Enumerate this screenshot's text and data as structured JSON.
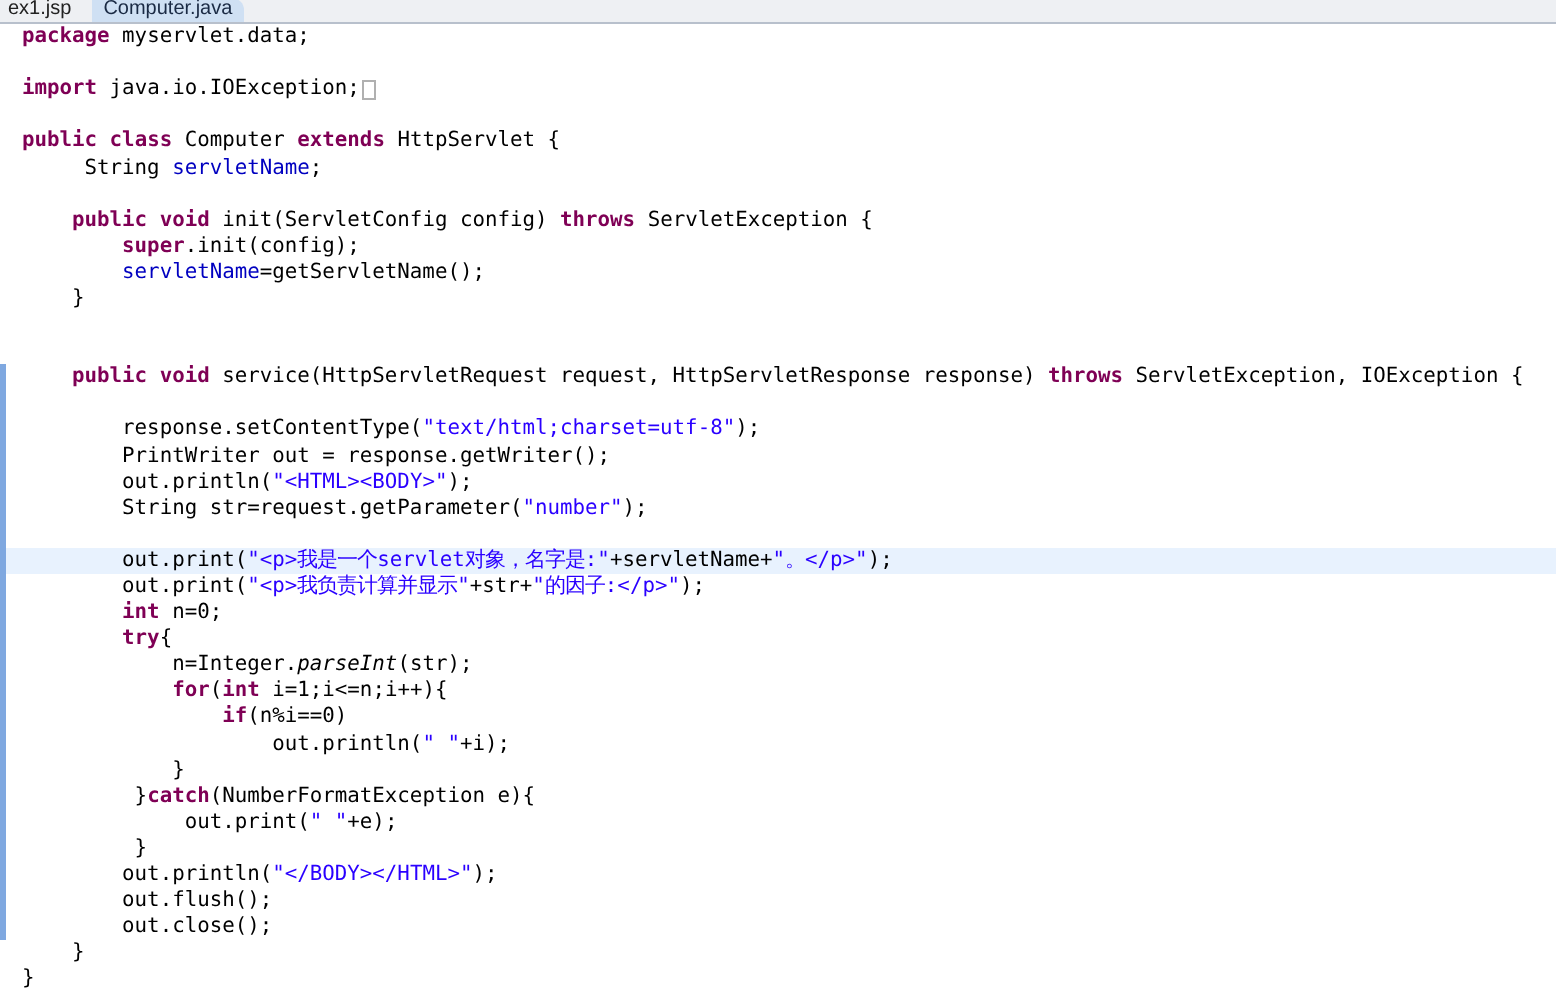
{
  "tabs": [
    {
      "label": "ex1.jsp",
      "selected": false
    },
    {
      "label": "Computer.java",
      "selected": true
    }
  ],
  "editor": {
    "lines": [
      {
        "kind": "code",
        "tokens": [
          {
            "kind": "kw",
            "t": "package"
          },
          {
            "kind": "plain",
            "t": " myservlet.data;"
          }
        ]
      },
      {
        "kind": "blank"
      },
      {
        "kind": "code",
        "tokens": [
          {
            "kind": "kw",
            "t": "import"
          },
          {
            "kind": "plain",
            "t": " java.io.IOException;"
          }
        ],
        "folded": true
      },
      {
        "kind": "blank"
      },
      {
        "kind": "code",
        "tokens": [
          {
            "kind": "kw",
            "t": "public"
          },
          {
            "kind": "kw",
            "t": " class"
          },
          {
            "kind": "plain",
            "t": " Computer "
          },
          {
            "kind": "kw",
            "t": "extends"
          },
          {
            "kind": "plain",
            "t": " HttpServlet {"
          }
        ]
      },
      {
        "kind": "code",
        "tokens": [
          {
            "kind": "plain",
            "t": "     String "
          },
          {
            "kind": "field",
            "t": "servletName"
          },
          {
            "kind": "plain",
            "t": ";"
          }
        ]
      },
      {
        "kind": "blank"
      },
      {
        "kind": "code",
        "tokens": [
          {
            "kind": "kw",
            "t": "    public"
          },
          {
            "kind": "kw",
            "t": " void"
          },
          {
            "kind": "plain",
            "t": " init(ServletConfig config) "
          },
          {
            "kind": "kw",
            "t": "throws"
          },
          {
            "kind": "plain",
            "t": " ServletException {"
          }
        ]
      },
      {
        "kind": "code",
        "tokens": [
          {
            "kind": "kw",
            "t": "        super"
          },
          {
            "kind": "plain",
            "t": ".init(config);"
          }
        ]
      },
      {
        "kind": "code",
        "tokens": [
          {
            "kind": "field",
            "t": "        servletName"
          },
          {
            "kind": "plain",
            "t": "=getServletName();"
          }
        ]
      },
      {
        "kind": "code",
        "tokens": [
          {
            "kind": "plain",
            "t": "    }"
          }
        ]
      },
      {
        "kind": "blank"
      },
      {
        "kind": "blank"
      },
      {
        "kind": "code",
        "tokens": [
          {
            "kind": "kw",
            "t": "    public"
          },
          {
            "kind": "kw",
            "t": " void"
          },
          {
            "kind": "plain",
            "t": " service(HttpServletRequest request, HttpServletResponse response) "
          },
          {
            "kind": "kw",
            "t": "throws"
          },
          {
            "kind": "plain",
            "t": " ServletException, IOException {"
          }
        ],
        "range": true
      },
      {
        "kind": "blank",
        "range": true
      },
      {
        "kind": "code",
        "tokens": [
          {
            "kind": "plain",
            "t": "        response.setContentType("
          },
          {
            "kind": "str",
            "t": "\"text/html;charset=utf-8\""
          },
          {
            "kind": "plain",
            "t": ");"
          }
        ],
        "range": true
      },
      {
        "kind": "code",
        "tokens": [
          {
            "kind": "plain",
            "t": "        PrintWriter out = response.getWriter();"
          }
        ],
        "range": true
      },
      {
        "kind": "code",
        "tokens": [
          {
            "kind": "plain",
            "t": "        out.println("
          },
          {
            "kind": "str",
            "t": "\"<HTML><BODY>\""
          },
          {
            "kind": "plain",
            "t": ");"
          }
        ],
        "range": true
      },
      {
        "kind": "code",
        "tokens": [
          {
            "kind": "plain",
            "t": "        String str=request.getParameter("
          },
          {
            "kind": "str",
            "t": "\"number\""
          },
          {
            "kind": "plain",
            "t": ");"
          }
        ],
        "range": true
      },
      {
        "kind": "blank",
        "range": true
      },
      {
        "kind": "code",
        "tokens": [
          {
            "kind": "plain",
            "t": "        out.print("
          },
          {
            "kind": "str",
            "t": "\"<p>我是一个servlet对象，名字是:\""
          },
          {
            "kind": "plain",
            "t": "+servletName+"
          },
          {
            "kind": "str",
            "t": "\"。</p>\""
          },
          {
            "kind": "plain",
            "t": ");"
          }
        ],
        "range": true,
        "current": true
      },
      {
        "kind": "code",
        "tokens": [
          {
            "kind": "plain",
            "t": "        out.print("
          },
          {
            "kind": "str",
            "t": "\"<p>我负责计算并显示\""
          },
          {
            "kind": "plain",
            "t": "+str+"
          },
          {
            "kind": "str",
            "t": "\"的因子:</p>\""
          },
          {
            "kind": "plain",
            "t": ");"
          }
        ],
        "range": true
      },
      {
        "kind": "code",
        "tokens": [
          {
            "kind": "kw",
            "t": "        int"
          },
          {
            "kind": "plain",
            "t": " n=0;"
          }
        ],
        "range": true
      },
      {
        "kind": "code",
        "tokens": [
          {
            "kind": "kw",
            "t": "        try"
          },
          {
            "kind": "plain",
            "t": "{"
          }
        ],
        "range": true
      },
      {
        "kind": "code",
        "tokens": [
          {
            "kind": "plain",
            "t": "            n=Integer."
          },
          {
            "kind": "italic",
            "t": "parseInt"
          },
          {
            "kind": "plain",
            "t": "(str);"
          }
        ],
        "range": true
      },
      {
        "kind": "code",
        "tokens": [
          {
            "kind": "kw",
            "t": "            for"
          },
          {
            "kind": "plain",
            "t": "("
          },
          {
            "kind": "kw",
            "t": "int"
          },
          {
            "kind": "plain",
            "t": " i=1;i<=n;i++){"
          }
        ],
        "range": true
      },
      {
        "kind": "code",
        "tokens": [
          {
            "kind": "kw",
            "t": "                if"
          },
          {
            "kind": "plain",
            "t": "(n%i==0)"
          }
        ],
        "range": true
      },
      {
        "kind": "code",
        "tokens": [
          {
            "kind": "plain",
            "t": "                    out.println("
          },
          {
            "kind": "str",
            "t": "\" \""
          },
          {
            "kind": "plain",
            "t": "+i);"
          }
        ],
        "range": true
      },
      {
        "kind": "code",
        "tokens": [
          {
            "kind": "plain",
            "t": "            }"
          }
        ],
        "range": true
      },
      {
        "kind": "code",
        "tokens": [
          {
            "kind": "plain",
            "t": "         }"
          },
          {
            "kind": "kw",
            "t": "catch"
          },
          {
            "kind": "plain",
            "t": "(NumberFormatException e){"
          }
        ],
        "range": true
      },
      {
        "kind": "code",
        "tokens": [
          {
            "kind": "plain",
            "t": "             out.print("
          },
          {
            "kind": "str",
            "t": "\" \""
          },
          {
            "kind": "plain",
            "t": "+e);"
          }
        ],
        "range": true
      },
      {
        "kind": "code",
        "tokens": [
          {
            "kind": "plain",
            "t": "         }"
          }
        ],
        "range": true
      },
      {
        "kind": "code",
        "tokens": [
          {
            "kind": "plain",
            "t": "        out.println("
          },
          {
            "kind": "str",
            "t": "\"</BODY></HTML>\""
          },
          {
            "kind": "plain",
            "t": ");"
          }
        ],
        "range": true
      },
      {
        "kind": "code",
        "tokens": [
          {
            "kind": "plain",
            "t": "        out.flush();"
          }
        ],
        "range": true
      },
      {
        "kind": "code",
        "tokens": [
          {
            "kind": "plain",
            "t": "        out.close();"
          }
        ],
        "range": true
      },
      {
        "kind": "code",
        "tokens": [
          {
            "kind": "plain",
            "t": "    }"
          }
        ]
      },
      {
        "kind": "code",
        "tokens": [
          {
            "kind": "plain",
            "t": "}"
          }
        ]
      }
    ]
  }
}
